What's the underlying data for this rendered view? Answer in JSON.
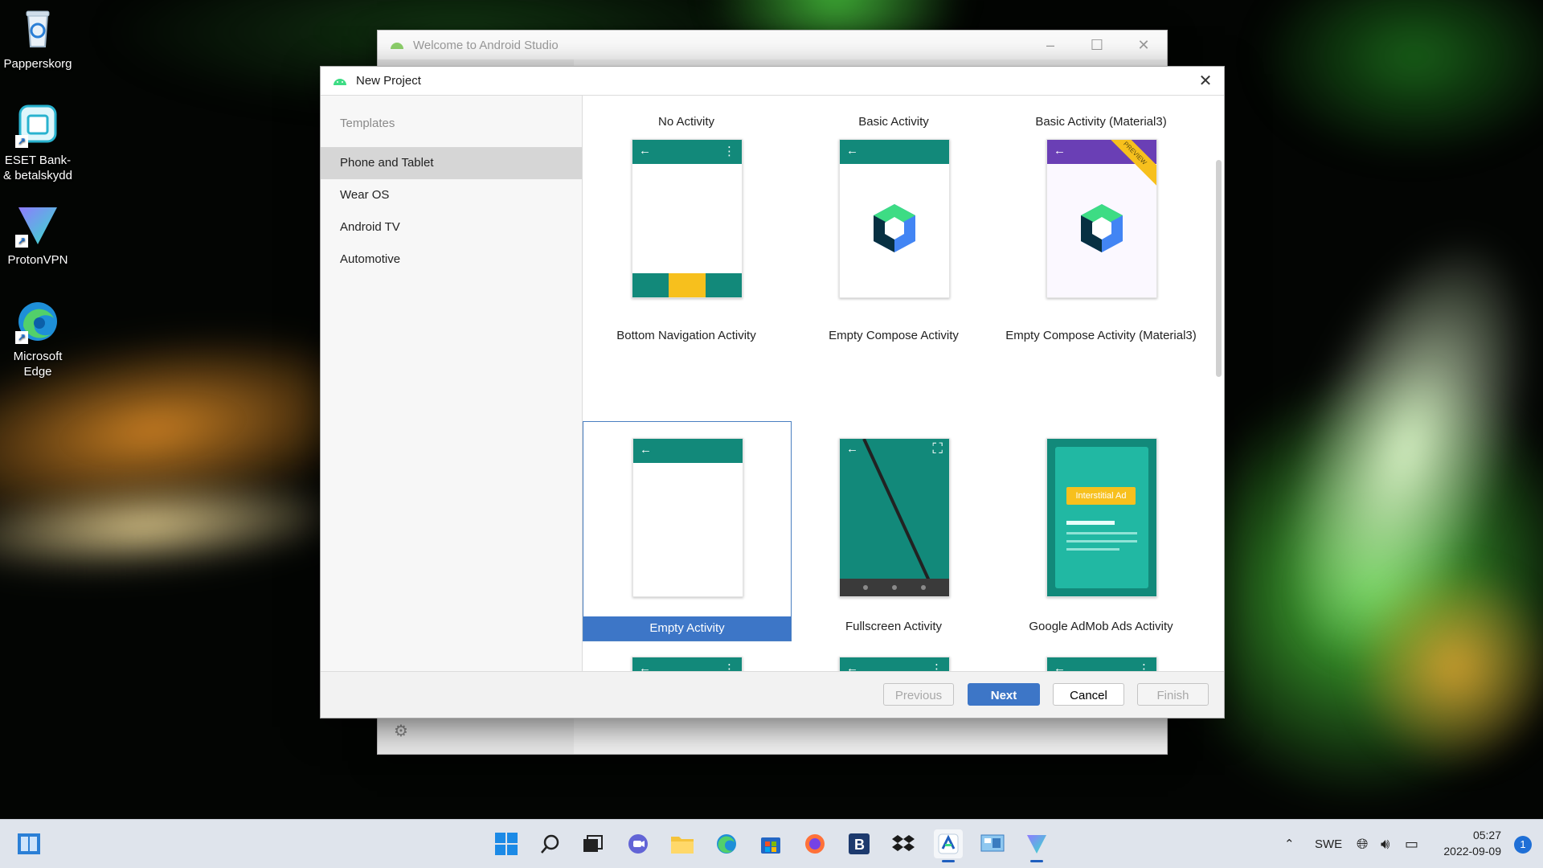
{
  "desktop": {
    "icons": [
      {
        "label": "Papperskorg"
      },
      {
        "label": "ESET Bank- & betalskydd"
      },
      {
        "label": "ProtonVPN"
      },
      {
        "label": "Microsoft Edge"
      }
    ]
  },
  "welcome_window": {
    "title": "Welcome to Android Studio"
  },
  "dialog": {
    "title": "New Project",
    "templates_heading": "Templates",
    "categories": [
      {
        "label": "Phone and Tablet",
        "selected": true
      },
      {
        "label": "Wear OS"
      },
      {
        "label": "Android TV"
      },
      {
        "label": "Automotive"
      }
    ],
    "templates": [
      {
        "name": "No Activity"
      },
      {
        "name": "Basic Activity"
      },
      {
        "name": "Basic Activity (Material3)",
        "badge": "PREVIEW"
      },
      {
        "name": "Bottom Navigation Activity"
      },
      {
        "name": "Empty Compose Activity"
      },
      {
        "name": "Empty Compose Activity (Material3)"
      },
      {
        "name": "Empty Activity",
        "selected": true
      },
      {
        "name": "Fullscreen Activity"
      },
      {
        "name": "Google AdMob Ads Activity",
        "ad_label": "Interstitial Ad"
      }
    ],
    "buttons": {
      "previous": "Previous",
      "next": "Next",
      "cancel": "Cancel",
      "finish": "Finish"
    }
  },
  "taskbar": {
    "language": "SWE",
    "time": "05:27",
    "date": "2022-09-09",
    "notifications": "1"
  },
  "colors": {
    "accent": "#3d76c7",
    "teal": "#12897a",
    "purple": "#6a3fb5",
    "yellow": "#f7c01d"
  }
}
